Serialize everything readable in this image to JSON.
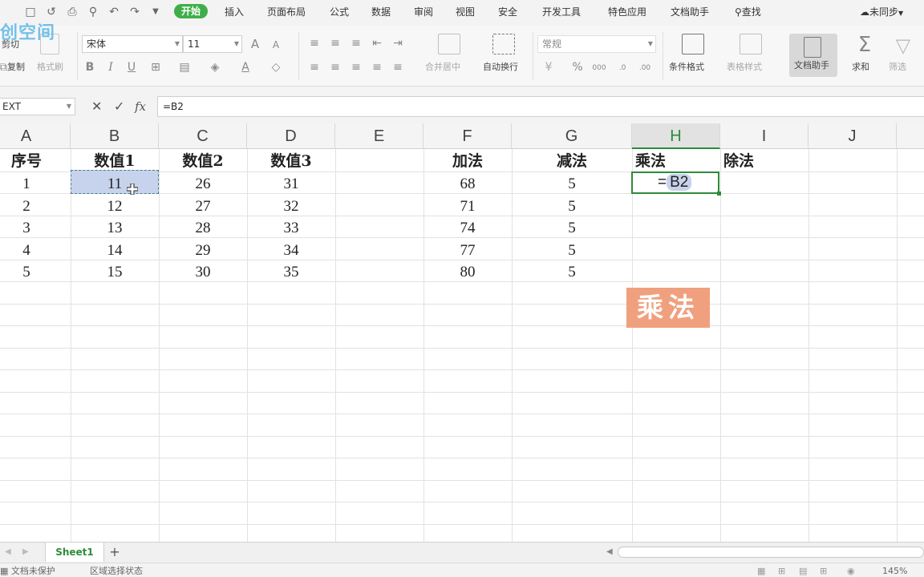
{
  "menubar": {
    "tabs": [
      "开始",
      "插入",
      "页面布局",
      "公式",
      "数据",
      "审阅",
      "视图",
      "安全",
      "开发工具",
      "特色应用",
      "文档助手"
    ],
    "active_tab": "开始",
    "search": "查找",
    "sync": "未同步"
  },
  "ribbon": {
    "cut": "剪切",
    "copy": "复制",
    "format_painter": "格式刷",
    "font_name": "宋体",
    "font_size": "11",
    "merge_center": "合并居中",
    "wrap_text": "自动换行",
    "number_format": "常规",
    "conditional_format": "条件格式",
    "table_style": "表格样式",
    "doc_assistant": "文档助手",
    "sum": "求和",
    "filter": "筛选",
    "watermark": "创空间"
  },
  "formulabar": {
    "name_box": "EXT",
    "formula": "=B2",
    "fx": "fx"
  },
  "grid": {
    "columns": [
      "A",
      "B",
      "C",
      "D",
      "E",
      "F",
      "G",
      "H",
      "I",
      "J"
    ],
    "selected_column": "H",
    "header_row": [
      "序号",
      "数值1",
      "数值2",
      "数值3",
      "",
      "加法",
      "减法",
      "乘法",
      "除法"
    ],
    "rows": [
      [
        "1",
        "11",
        "26",
        "31",
        "",
        "68",
        "5"
      ],
      [
        "2",
        "12",
        "27",
        "32",
        "",
        "71",
        "5"
      ],
      [
        "3",
        "13",
        "28",
        "33",
        "",
        "74",
        "5"
      ],
      [
        "4",
        "14",
        "29",
        "34",
        "",
        "77",
        "5"
      ],
      [
        "5",
        "15",
        "30",
        "35",
        "",
        "80",
        "5"
      ]
    ],
    "editing_cell": "H2",
    "edit_prefix": "=",
    "edit_ref": "B2",
    "stamp": "乘法"
  },
  "tabs": {
    "sheet": "Sheet1",
    "add": "+"
  },
  "status": {
    "protect": "文档未保护",
    "mode": "区域选择状态",
    "zoom": "145%"
  },
  "colors": {
    "accent_green": "#3fae49",
    "selection_fill": "#c7d3ec",
    "stamp_bg": "#f0a07e"
  }
}
